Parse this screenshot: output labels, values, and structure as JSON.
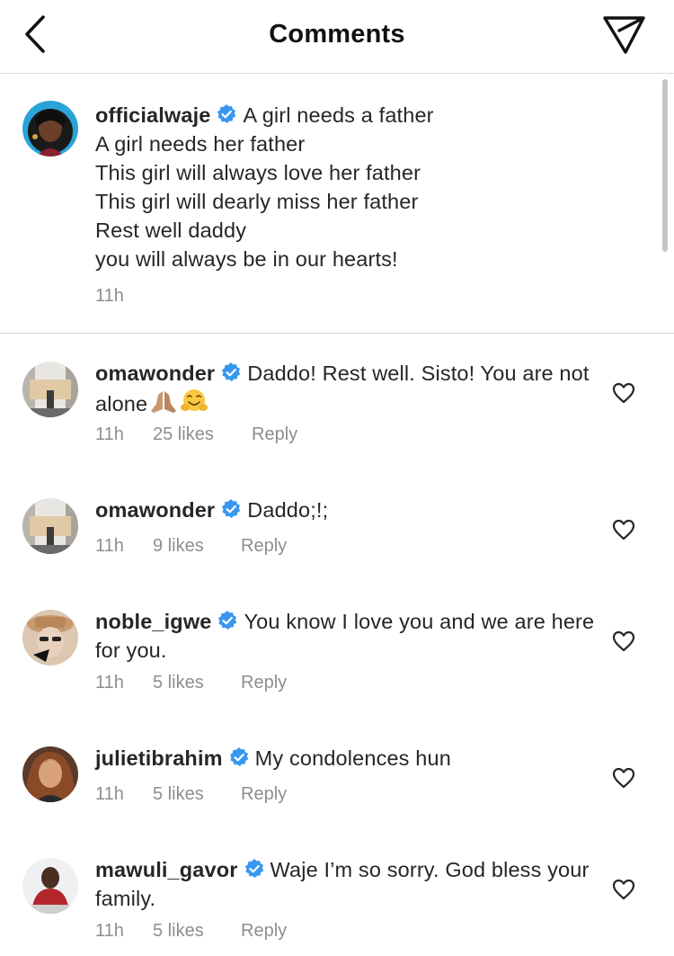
{
  "header": {
    "title": "Comments"
  },
  "caption": {
    "username": "officialwaje",
    "lines": [
      "A girl needs a father",
      "A girl needs her father",
      "This girl will always love her father",
      "This girl will dearly miss her father",
      "Rest well daddy",
      "you will always be in our hearts!"
    ],
    "time": "11h"
  },
  "comments": [
    {
      "username": "omawonder",
      "text": "Daddo! Rest well.  Sisto! You are not alone",
      "emojis": [
        "folded-hands-emoji",
        "hugging-face-emoji"
      ],
      "time": "11h",
      "likes": "25 likes",
      "reply": "Reply"
    },
    {
      "username": "omawonder",
      "text": "Daddo;!;",
      "time": "11h",
      "likes": "9 likes",
      "reply": "Reply"
    },
    {
      "username": "noble_igwe",
      "text": "You know I love you and we are here for you.",
      "time": "11h",
      "likes": "5 likes",
      "reply": "Reply"
    },
    {
      "username": "julietibrahim",
      "text": "My condolences hun",
      "time": "11h",
      "likes": "5 likes",
      "reply": "Reply"
    },
    {
      "username": "mawuli_gavor",
      "text": "Waje I’m so sorry. God bless your family.",
      "time": "11h",
      "likes": "5 likes",
      "reply": "Reply"
    }
  ],
  "colors": {
    "verified": "#3897f0",
    "secondary_text": "#8e8e8e",
    "divider": "#dbdbdb"
  },
  "icons": {
    "back": "chevron-left-icon",
    "send": "paper-plane-icon",
    "like": "heart-outline-icon",
    "verified": "verified-badge-icon"
  }
}
